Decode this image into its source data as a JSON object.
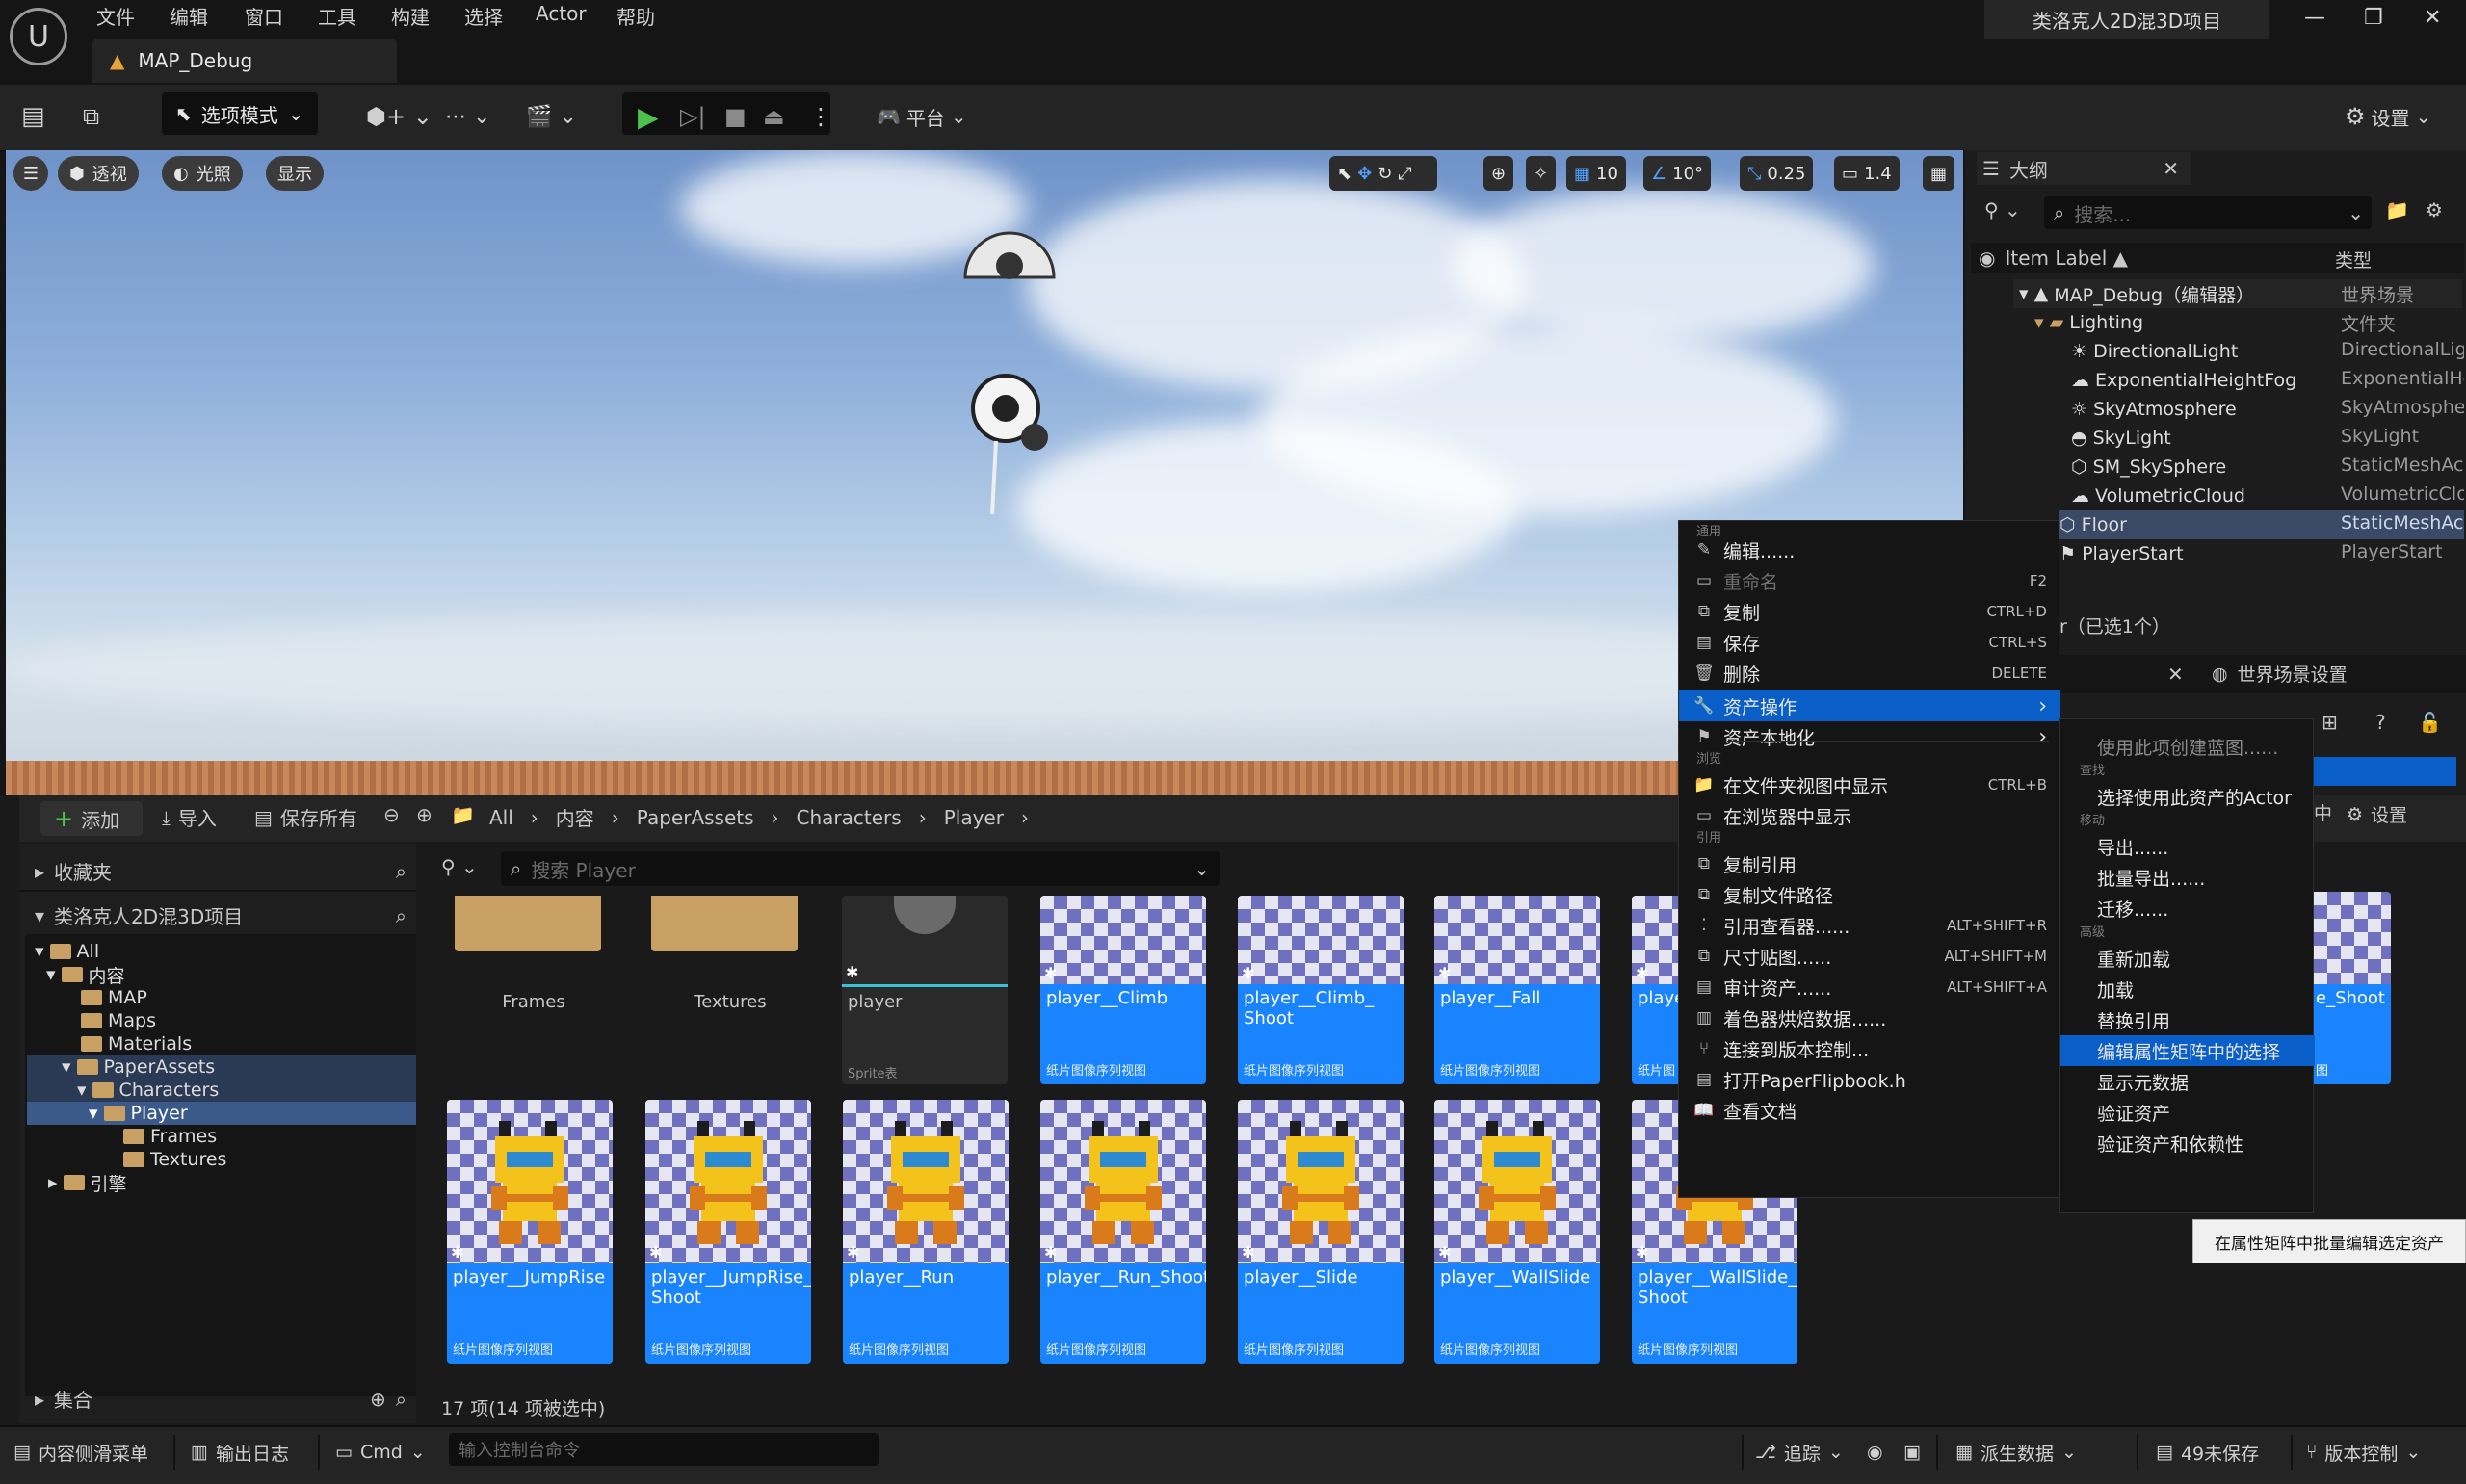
{
  "app": {
    "menu": [
      "文件",
      "编辑",
      "窗口",
      "工具",
      "构建",
      "选择",
      "Actor",
      "帮助"
    ],
    "map_tab": "MAP_Debug",
    "project_title": "类洛克人2D混3D项目"
  },
  "toolbar": {
    "mode_label": "选项模式",
    "platform_label": "平台",
    "settings_label": "设置"
  },
  "viewport": {
    "perspective": "透视",
    "lighting": "光照",
    "show": "显示",
    "grid_snap": "10",
    "rot_snap": "10°",
    "scale_snap": "0.25",
    "cam_speed": "1.4"
  },
  "outline": {
    "title": "大纲",
    "search_placeholder": "搜索...",
    "col_label": "Item Label ▲",
    "col_type": "类型",
    "rows": [
      {
        "label": "MAP_Debug（编辑器）",
        "type": "世界场景"
      },
      {
        "label": "Lighting",
        "type": "文件夹"
      },
      {
        "label": "DirectionalLight",
        "type": "DirectionalLig"
      },
      {
        "label": "ExponentialHeightFog",
        "type": "ExponentialHe"
      },
      {
        "label": "SkyAtmosphere",
        "type": "SkyAtmosphe"
      },
      {
        "label": "SkyLight",
        "type": "SkyLight"
      },
      {
        "label": "SM_SkySphere",
        "type": "StaticMeshAc"
      },
      {
        "label": "VolumetricCloud",
        "type": "VolumetricClo"
      },
      {
        "label": "Floor",
        "type": "StaticMeshAc"
      },
      {
        "label": "PlayerStart",
        "type": "PlayerStart"
      }
    ],
    "selection_status": "r（已选1个）",
    "world_settings_tab": "世界场景设置",
    "details_settings": "设置",
    "details_cut_label": "中",
    "details_cut_asset": "e_Shoot"
  },
  "content_browser": {
    "add": "添加",
    "import": "导入",
    "save_all": "保存所有",
    "breadcrumb": [
      "All",
      "内容",
      "PaperAssets",
      "Characters",
      "Player"
    ],
    "favorites": "收藏夹",
    "project": "类洛克人2D混3D项目",
    "tree": [
      "All",
      "内容",
      "MAP",
      "Maps",
      "Materials",
      "PaperAssets",
      "Characters",
      "Player",
      "Frames",
      "Textures",
      "引擎"
    ],
    "collections": "集合",
    "search_placeholder": "搜索 Player",
    "folders": [
      "Frames",
      "Textures"
    ],
    "player_asset": {
      "name": "player",
      "type": "Sprite表"
    },
    "assets_row1": [
      {
        "name": "player__Climb",
        "type": "纸片图像序列视图"
      },
      {
        "name": "player__Climb_\nShoot",
        "type": "纸片图像序列视图"
      },
      {
        "name": "player__Fall",
        "type": "纸片图像序列视图"
      },
      {
        "name": "playe",
        "type": "纸片图"
      }
    ],
    "assets_row2": [
      {
        "name": "player__JumpRise",
        "type": "纸片图像序列视图"
      },
      {
        "name": "player__JumpRise_\nShoot",
        "type": "纸片图像序列视图"
      },
      {
        "name": "player__Run",
        "type": "纸片图像序列视图"
      },
      {
        "name": "player__Run_Shoot",
        "type": "纸片图像序列视图"
      },
      {
        "name": "player__Slide",
        "type": "纸片图像序列视图"
      },
      {
        "name": "player__WallSlide",
        "type": "纸片图像序列视图"
      },
      {
        "name": "player__WallSlide_\nShoot",
        "type": "纸片图像序列视图"
      }
    ],
    "right_asset_type": "图",
    "item_count": "17 项(14 项被选中)"
  },
  "context_menu": {
    "sections": {
      "general": "通用",
      "browse": "浏览",
      "references": "引用"
    },
    "items": [
      {
        "label": "编辑......",
        "shortcut": ""
      },
      {
        "label": "重命名",
        "shortcut": "F2"
      },
      {
        "label": "复制",
        "shortcut": "CTRL+D"
      },
      {
        "label": "保存",
        "shortcut": "CTRL+S"
      },
      {
        "label": "删除",
        "shortcut": "DELETE"
      },
      {
        "label": "资产操作",
        "shortcut": "›"
      },
      {
        "label": "资产本地化",
        "shortcut": "›"
      },
      {
        "label": "在文件夹视图中显示",
        "shortcut": "CTRL+B"
      },
      {
        "label": "在浏览器中显示",
        "shortcut": ""
      },
      {
        "label": "复制引用",
        "shortcut": ""
      },
      {
        "label": "复制文件路径",
        "shortcut": ""
      },
      {
        "label": "引用查看器......",
        "shortcut": "ALT+SHIFT+R"
      },
      {
        "label": "尺寸贴图......",
        "shortcut": "ALT+SHIFT+M"
      },
      {
        "label": "审计资产......",
        "shortcut": "ALT+SHIFT+A"
      },
      {
        "label": "着色器烘焙数据......",
        "shortcut": ""
      },
      {
        "label": "连接到版本控制...",
        "shortcut": ""
      },
      {
        "label": "打开PaperFlipbook.h",
        "shortcut": ""
      },
      {
        "label": "查看文档",
        "shortcut": ""
      }
    ]
  },
  "submenu": {
    "items": [
      {
        "label": "使用此项创建蓝图......"
      },
      {
        "section": "查找"
      },
      {
        "label": "选择使用此资产的Actor"
      },
      {
        "section": "移动"
      },
      {
        "label": "导出......"
      },
      {
        "label": "批量导出......"
      },
      {
        "label": "迁移......"
      },
      {
        "section": "高级"
      },
      {
        "label": "重新加载"
      },
      {
        "label": "加载"
      },
      {
        "label": "替换引用"
      },
      {
        "label": "编辑属性矩阵中的选择"
      },
      {
        "label": "显示元数据"
      },
      {
        "label": "验证资产"
      },
      {
        "label": "验证资产和依赖性"
      }
    ]
  },
  "tooltip": "在属性矩阵中批量编辑选定资产",
  "statusbar": {
    "content_drawer": "内容侧滑菜单",
    "output_log": "输出日志",
    "cmd": "Cmd",
    "console_placeholder": "输入控制台命令",
    "trace": "追踪",
    "derived_data": "派生数据",
    "unsaved": "49未保存",
    "source_control": "版本控制"
  },
  "colors": {
    "accent": "#1a84ff",
    "highlight": "#0a5ec8",
    "panel": "#1c1c1c"
  }
}
